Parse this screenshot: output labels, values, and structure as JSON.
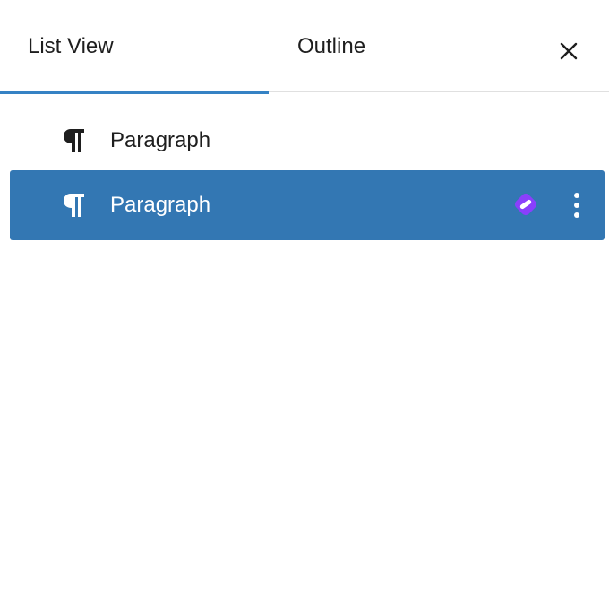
{
  "tabs": {
    "list_view": "List View",
    "outline": "Outline"
  },
  "close": {
    "icon": "close-icon"
  },
  "items": [
    {
      "label": "Paragraph",
      "icon": "pilcrow-icon",
      "selected": false
    },
    {
      "label": "Paragraph",
      "icon": "pilcrow-icon",
      "selected": true,
      "badge_icon": "highlight-badge-icon",
      "menu_icon": "more-vertical-icon"
    }
  ],
  "colors": {
    "accent": "#3582c4",
    "selected_bg": "#3377b3",
    "badge": "#8a3ffc"
  }
}
